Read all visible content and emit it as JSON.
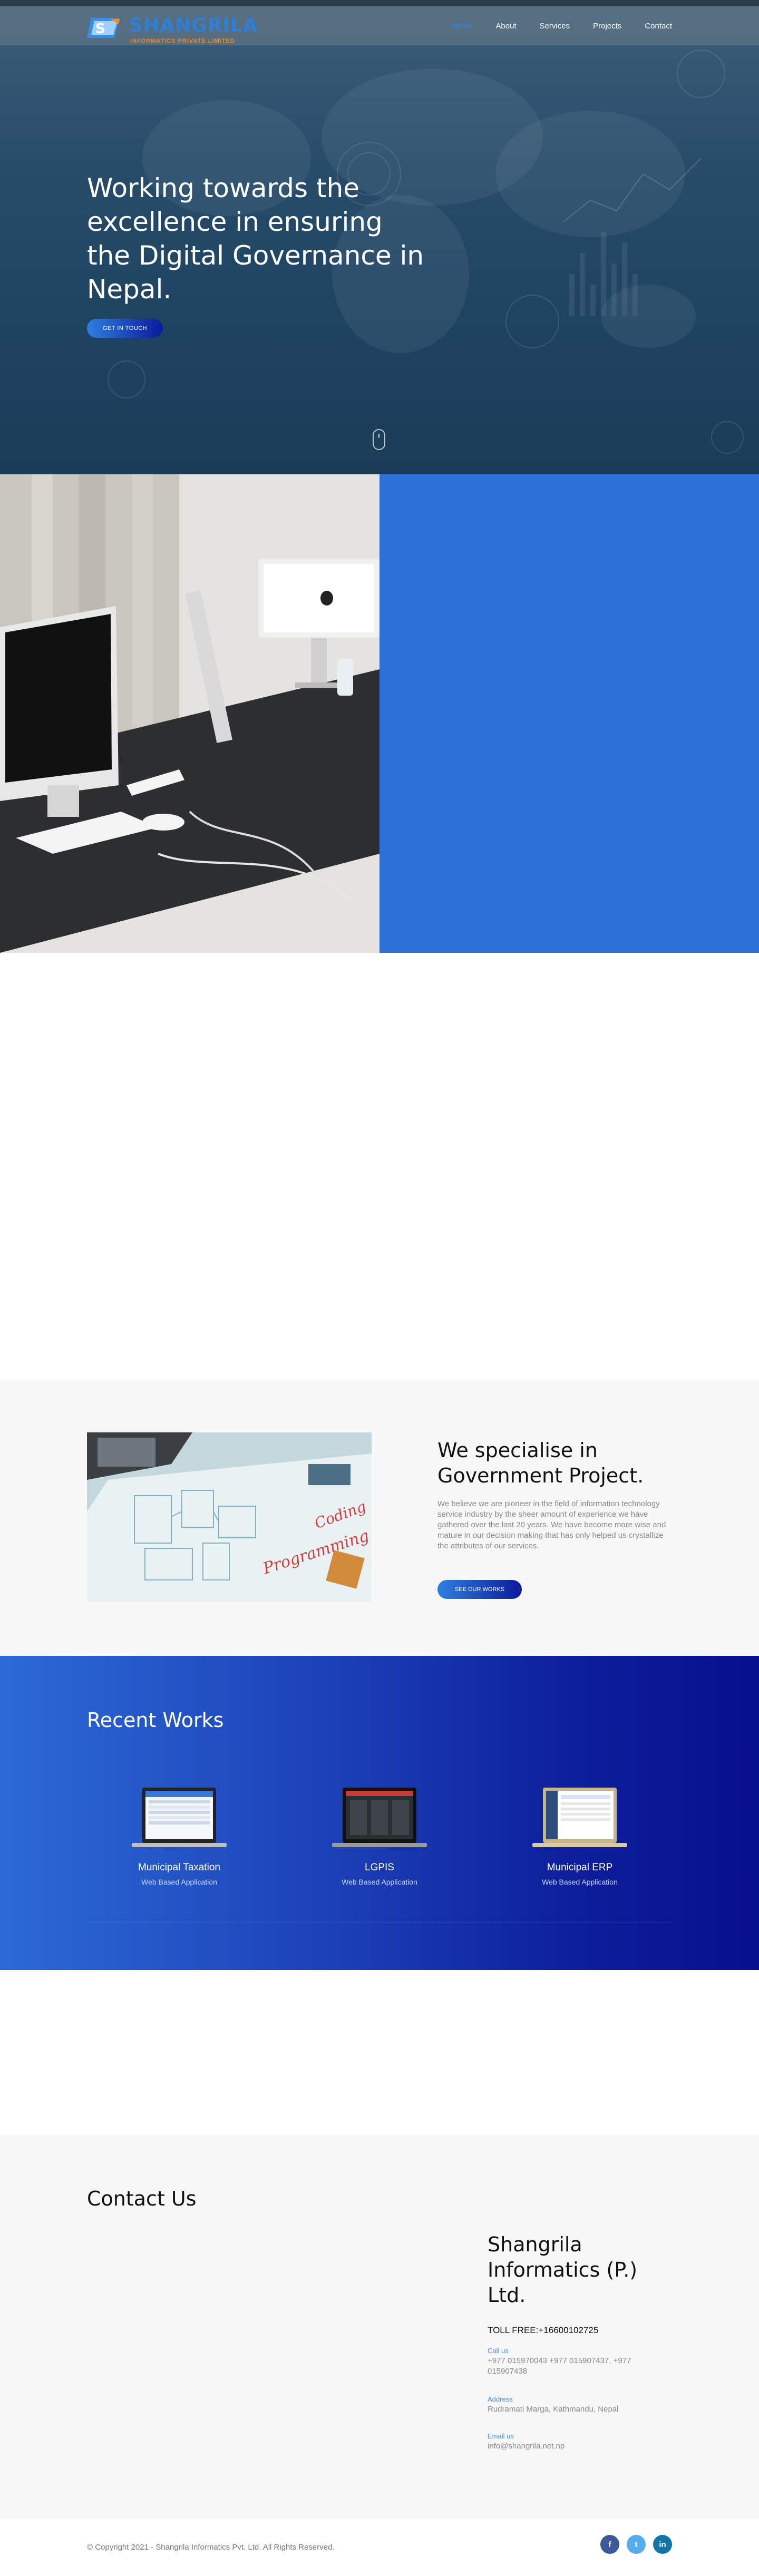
{
  "brand": {
    "name": "SHANGRILA",
    "tagline": "INFORMATICS PRIVATE LIMITED"
  },
  "nav": {
    "items": [
      {
        "label": "Home",
        "active": true
      },
      {
        "label": "About",
        "active": false
      },
      {
        "label": "Services",
        "active": false
      },
      {
        "label": "Projects",
        "active": false
      },
      {
        "label": "Contact",
        "active": false
      }
    ]
  },
  "hero": {
    "title": "Working towards the excellence in ensuring the Digital Governance in Nepal.",
    "button": "GET IN TOUCH"
  },
  "specialise": {
    "title": "We specialise in Government Project.",
    "text": "We believe we are pioneer in the field of information technology service industry by the sheer amount of experience we have gathered over the last 20 years. We have become more wise and mature in our decision making that has only helped us crystallize the attributes of our services.",
    "button": "SEE OUR WORKS",
    "image_text_1": "Coding",
    "image_text_2": "Programming"
  },
  "works": {
    "title": "Recent Works",
    "items": [
      {
        "title": "Municipal Taxation",
        "subtitle": "Web Based Application"
      },
      {
        "title": "LGPIS",
        "subtitle": "Web Based Application"
      },
      {
        "title": "Municipal ERP",
        "subtitle": "Web Based Application"
      }
    ]
  },
  "contact": {
    "title": "Contact Us",
    "company": "Shangrila Informatics (P.) Ltd.",
    "toll_free": "TOLL FREE:+16600102725",
    "call_label": "Call us",
    "call_value": "+977 015970043 +977 015907437, +977 015907438",
    "address_label": "Address",
    "address_value": "Rudramati Marga, Kathmandu, Nepal",
    "email_label": "Email us",
    "email_value": "info@shangrila.net.np"
  },
  "footer": {
    "copyright": "© Copyright 2021 - Shangrila Informatics Pvt. Ltd. All Rights Reserved.",
    "socials": [
      {
        "icon": "facebook-icon",
        "glyph": "f",
        "color": "#3b5998"
      },
      {
        "icon": "twitter-icon",
        "glyph": "t",
        "color": "#55acee"
      },
      {
        "icon": "linkedin-icon",
        "glyph": "in",
        "color": "#0e76a8"
      }
    ]
  },
  "colors": {
    "accent": "#2f86f0",
    "brand_blue": "#2c70d8",
    "brand_orange": "#f28d1f",
    "deep_blue": "#070f8e"
  }
}
